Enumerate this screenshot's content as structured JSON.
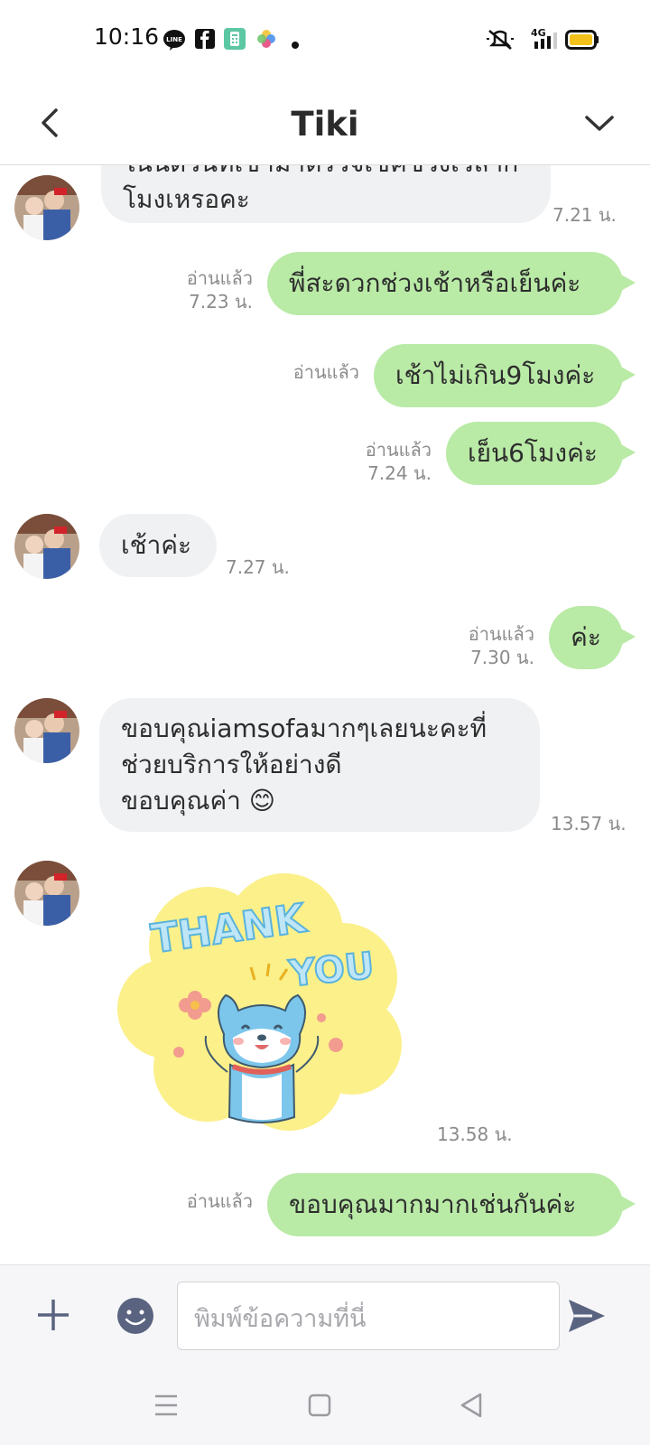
{
  "status_bar": {
    "time": "10:16",
    "network": "4G",
    "icons": [
      "line-app-icon",
      "facebook-icon",
      "calculator-icon",
      "photos-icon",
      "dot-icon",
      "mute-icon",
      "signal-icon",
      "battery-icon"
    ]
  },
  "header": {
    "title": "Tiki",
    "back_icon": "back-arrow-icon",
    "menu_icon": "chevron-down-icon"
  },
  "messages": [
    {
      "direction": "in",
      "lines": [
        "ในนัดวันที่เข้ามาตรวจเช็คช่วงเวลากี่",
        "โมงเหรอคะ"
      ],
      "time": "7.21 น."
    },
    {
      "direction": "out",
      "text": "พี่สะดวกช่วงเช้าหรือเย็นค่ะ",
      "read": "อ่านแล้ว",
      "time": "7.23 น."
    },
    {
      "direction": "out",
      "text": "เช้าไม่เกิน9โมงค่ะ",
      "read": "อ่านแล้ว",
      "time": ""
    },
    {
      "direction": "out",
      "text": "เย็น6โมงค่ะ",
      "read": "อ่านแล้ว",
      "time": "7.24 น."
    },
    {
      "direction": "in",
      "text": "เช้าค่ะ",
      "time": "7.27 น."
    },
    {
      "direction": "out",
      "text": "ค่ะ",
      "read": "อ่านแล้ว",
      "time": "7.30 น."
    },
    {
      "direction": "in",
      "lines": [
        "ขอบคุณiamsofaมากๆเลยนะคะที่",
        "ช่วยบริการให้อย่างดี",
        "ขอบคุณค่า 😊"
      ],
      "time": "13.57 น."
    },
    {
      "direction": "in",
      "type": "sticker",
      "sticker": {
        "line1": "THANK",
        "line2": "YOU"
      },
      "time": "13.58 น."
    },
    {
      "direction": "out",
      "text": "ขอบคุณมากมากเช่นกันค่ะ",
      "read": "อ่านแล้ว",
      "time": ""
    }
  ],
  "input": {
    "placeholder": "พิมพ์ข้อความที่นี่",
    "plus_icon": "plus-icon",
    "emoji_icon": "emoji-icon",
    "send_icon": "send-icon"
  },
  "nav": {
    "icons": [
      "recent-apps-icon",
      "home-icon",
      "back-icon"
    ]
  },
  "colors": {
    "outgoing_bubble": "#b9eaa6",
    "incoming_bubble": "#f0f1f3",
    "accent_icon": "#5a6380"
  }
}
